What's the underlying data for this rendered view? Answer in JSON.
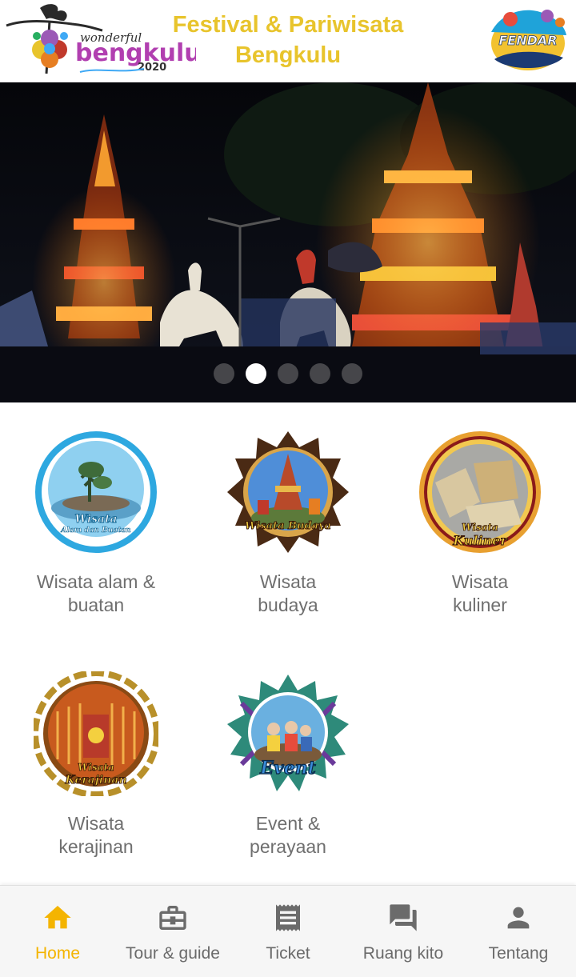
{
  "header": {
    "title_line1": "Festival & Pariwisata",
    "title_line2": "Bengkulu",
    "logo_left": {
      "small": "wonderful",
      "main": "bengkulu",
      "year": "2020"
    },
    "logo_right": {
      "text": "FENDAR"
    }
  },
  "banner": {
    "slide_count": 5,
    "active_slide": 2
  },
  "categories": [
    {
      "label_line1": "Wisata alam &",
      "label_line2": "buatan",
      "badge": "Wisata",
      "badge_sub": "Alam dan Buatan",
      "icon": "nature-emblem-icon"
    },
    {
      "label_line1": "Wisata",
      "label_line2": "budaya",
      "badge": "Wisata Budaya",
      "badge_sub": "",
      "icon": "culture-emblem-icon"
    },
    {
      "label_line1": "Wisata",
      "label_line2": "kuliner",
      "badge": "Wisata",
      "badge_sub": "Kuliner",
      "icon": "culinary-emblem-icon"
    },
    {
      "label_line1": "Wisata",
      "label_line2": "kerajinan",
      "badge": "Wisata",
      "badge_sub": "Kerajinan",
      "icon": "craft-emblem-icon"
    },
    {
      "label_line1": "Event &",
      "label_line2": "perayaan",
      "badge": "Event",
      "badge_sub": "",
      "icon": "event-emblem-icon"
    }
  ],
  "nav": {
    "active": "home",
    "active_color": "#f4b400",
    "inactive_color": "#6b6b6b",
    "items": [
      {
        "label": "Home",
        "icon": "home-icon"
      },
      {
        "label": "Tour & guide",
        "icon": "briefcase-icon"
      },
      {
        "label": "Ticket",
        "icon": "ticket-icon"
      },
      {
        "label": "Ruang kito",
        "icon": "chat-icon"
      },
      {
        "label": "Tentang",
        "icon": "person-icon"
      }
    ]
  },
  "colors": {
    "title_yellow": "#e8c42c"
  }
}
